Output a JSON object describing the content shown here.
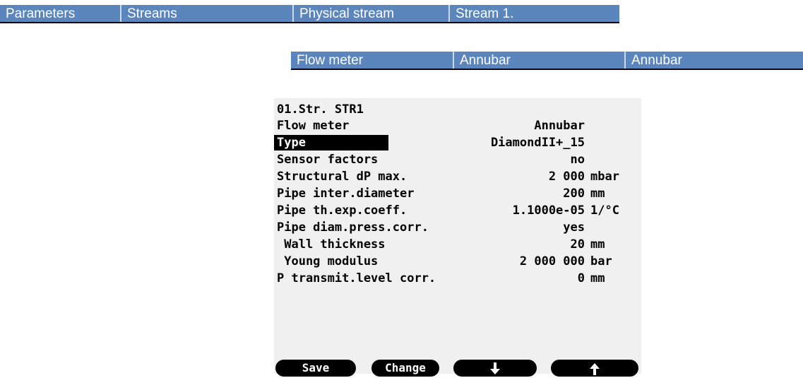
{
  "breadcrumb_top": [
    "Parameters",
    "Streams",
    "Physical stream",
    "Stream 1."
  ],
  "breadcrumb_sub": [
    "Flow meter",
    "Annubar",
    "Annubar"
  ],
  "lcd": {
    "title": "01.Str. STR1",
    "rows": [
      {
        "label": "Flow meter",
        "value": "Annubar",
        "unit": ""
      },
      {
        "label": "Type",
        "value": "DiamondII+_15",
        "unit": "",
        "selected": true
      },
      {
        "label": "Sensor factors",
        "value": "no",
        "unit": ""
      },
      {
        "label": "Structural dP max.",
        "value": "2 000",
        "unit": "mbar"
      },
      {
        "label": "Pipe inter.diameter",
        "value": "200",
        "unit": "mm"
      },
      {
        "label": "Pipe th.exp.coeff.",
        "value": "1.1000e-05",
        "unit": "1/°C"
      },
      {
        "label": "Pipe diam.press.corr.",
        "value": "yes",
        "unit": ""
      },
      {
        "label": " Wall thickness",
        "value": "20",
        "unit": "mm"
      },
      {
        "label": " Young modulus",
        "value": "2 000 000",
        "unit": "bar"
      },
      {
        "label": "P transmit.level corr.",
        "value": "0",
        "unit": "mm"
      }
    ]
  },
  "softkeys": {
    "save": "Save",
    "change": "Change",
    "down_icon": "arrow-down-icon",
    "up_icon": "arrow-up-icon"
  },
  "colors": {
    "breadcrumb_bg": "#5a86bd",
    "breadcrumb_text": "#ffffff",
    "lcd_bg": "#f0f0f0",
    "selection": "#000000"
  }
}
